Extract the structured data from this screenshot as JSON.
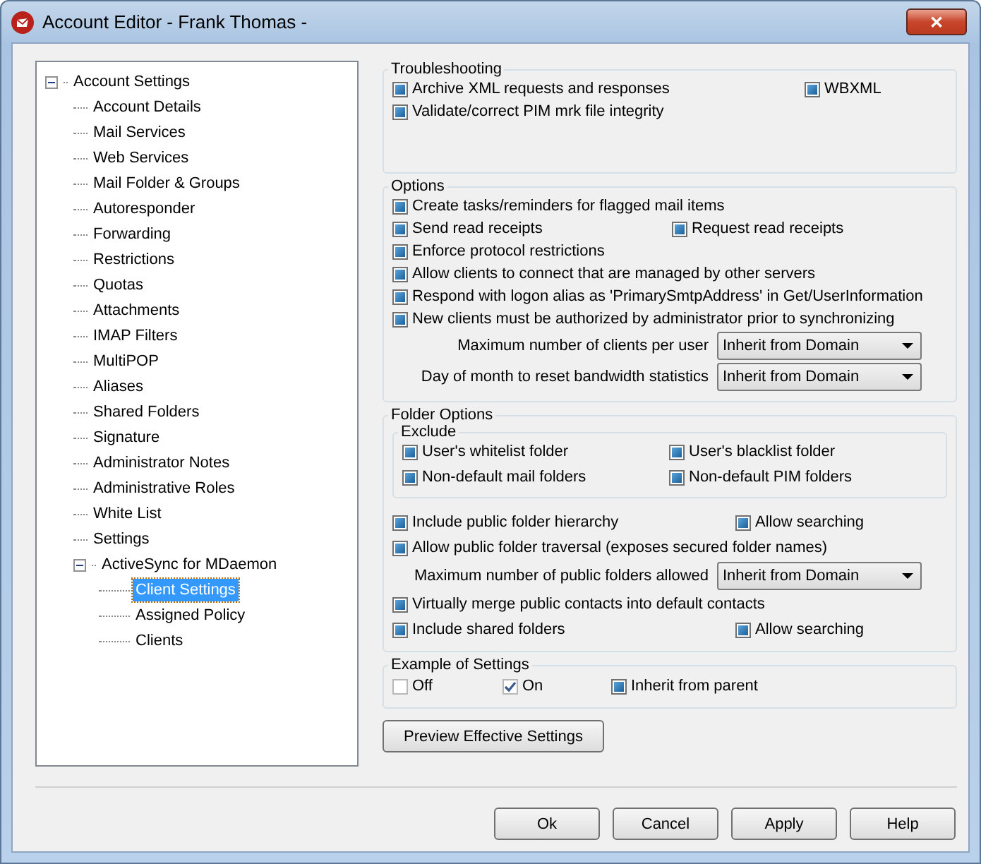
{
  "window": {
    "title": "Account Editor - Frank Thomas -",
    "close": "✕"
  },
  "tree": [
    {
      "label": "Account Settings",
      "expanded": true,
      "selected": false,
      "children": [
        {
          "label": "Account Details",
          "selected": false
        },
        {
          "label": "Mail Services",
          "selected": false
        },
        {
          "label": "Web Services",
          "selected": false
        },
        {
          "label": "Mail Folder & Groups",
          "selected": false
        },
        {
          "label": "Autoresponder",
          "selected": false
        },
        {
          "label": "Forwarding",
          "selected": false
        },
        {
          "label": "Restrictions",
          "selected": false
        },
        {
          "label": "Quotas",
          "selected": false
        },
        {
          "label": "Attachments",
          "selected": false
        },
        {
          "label": "IMAP Filters",
          "selected": false
        },
        {
          "label": "MultiPOP",
          "selected": false
        },
        {
          "label": "Aliases",
          "selected": false
        },
        {
          "label": "Shared Folders",
          "selected": false
        },
        {
          "label": "Signature",
          "selected": false
        },
        {
          "label": "Administrator Notes",
          "selected": false
        },
        {
          "label": "Administrative Roles",
          "selected": false
        },
        {
          "label": "White List",
          "selected": false
        },
        {
          "label": "Settings",
          "selected": false
        },
        {
          "label": "ActiveSync for MDaemon",
          "expanded": true,
          "selected": false,
          "children": [
            {
              "label": "Client Settings",
              "selected": true
            },
            {
              "label": "Assigned Policy",
              "selected": false
            },
            {
              "label": "Clients",
              "selected": false
            }
          ]
        }
      ]
    }
  ],
  "groups": [
    {
      "title": "Troubleshooting",
      "rows": [
        {
          "kind": "checks",
          "items": [
            {
              "label": "Archive XML requests and responses",
              "inherited": true
            },
            {
              "label": "WBXML",
              "inherited": true
            }
          ]
        },
        {
          "kind": "checks",
          "items": [
            {
              "label": "Validate/correct PIM mrk file integrity",
              "inherited": true
            }
          ]
        }
      ]
    },
    {
      "title": "Options",
      "rows": [
        {
          "kind": "checks",
          "items": [
            {
              "label": "Create tasks/reminders for flagged mail items",
              "inherited": true
            }
          ]
        },
        {
          "kind": "checks",
          "items": [
            {
              "label": "Send read receipts",
              "inherited": true
            },
            {
              "label": "Request read receipts",
              "inherited": true
            }
          ]
        },
        {
          "kind": "checks",
          "items": [
            {
              "label": "Enforce protocol restrictions",
              "inherited": true
            }
          ]
        },
        {
          "kind": "checks",
          "items": [
            {
              "label": "Allow clients to connect that are managed by other servers",
              "inherited": true
            }
          ]
        },
        {
          "kind": "checks",
          "items": [
            {
              "label": "Respond with logon alias as 'PrimarySmtpAddress' in Get/UserInformation",
              "inherited": true
            }
          ]
        },
        {
          "kind": "checks",
          "items": [
            {
              "label": "New clients must be authorized by administrator prior to synchronizing",
              "inherited": true
            }
          ]
        },
        {
          "kind": "select",
          "label": "Maximum number of clients per user",
          "value": "Inherit from Domain"
        },
        {
          "kind": "select",
          "label": "Day of month to reset bandwidth statistics",
          "value": "Inherit from Domain"
        }
      ]
    },
    {
      "title": "Folder Options",
      "rows": [
        {
          "kind": "subgroup",
          "title": "Exclude",
          "rows": [
            {
              "kind": "checks",
              "items": [
                {
                  "label": "User's whitelist folder",
                  "inherited": true
                },
                {
                  "label": "User's blacklist folder",
                  "inherited": true
                }
              ]
            },
            {
              "kind": "checks",
              "items": [
                {
                  "label": "Non-default mail folders",
                  "inherited": true
                },
                {
                  "label": "Non-default PIM folders",
                  "inherited": true
                }
              ]
            }
          ]
        },
        {
          "kind": "checks",
          "items": [
            {
              "label": "Include public folder hierarchy",
              "inherited": true
            },
            {
              "label": "Allow searching",
              "inherited": true
            }
          ]
        },
        {
          "kind": "checks",
          "items": [
            {
              "label": "Allow public folder traversal (exposes secured folder names)",
              "inherited": true
            }
          ]
        },
        {
          "kind": "select",
          "label": "Maximum number of public folders allowed",
          "value": "Inherit from Domain"
        },
        {
          "kind": "checks",
          "items": [
            {
              "label": "Virtually merge public contacts into default contacts",
              "inherited": true
            }
          ]
        },
        {
          "kind": "checks",
          "items": [
            {
              "label": "Include shared folders",
              "inherited": true
            },
            {
              "label": "Allow searching",
              "inherited": true
            }
          ]
        }
      ]
    },
    {
      "title": "Example of Settings",
      "rows": [
        {
          "kind": "checks",
          "items": [
            {
              "label": "Off",
              "checked": false,
              "inherited": false
            },
            {
              "label": "On",
              "checked": true,
              "inherited": false
            },
            {
              "label": "Inherit from parent",
              "inherited": true
            }
          ]
        }
      ]
    }
  ],
  "preview_button": "Preview Effective Settings",
  "buttons": [
    "Ok",
    "Cancel",
    "Apply",
    "Help"
  ]
}
